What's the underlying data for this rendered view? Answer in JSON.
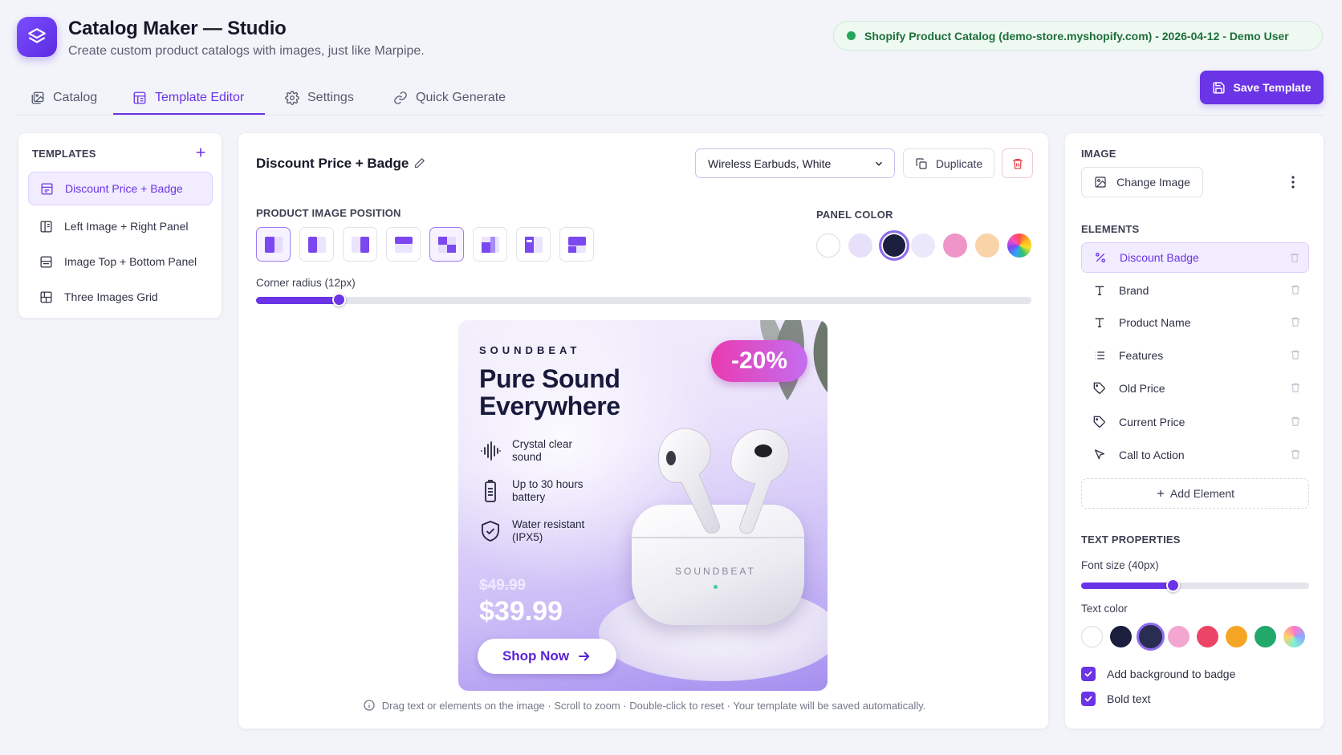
{
  "app": {
    "title": "Catalog Maker — Studio",
    "subtitle": "Create custom product catalogs with images, just like Marpipe.",
    "status": "Shopify Product Catalog (demo-store.myshopify.com) - 2026-04-12 - Demo User"
  },
  "tabs": [
    {
      "label": "Catalog",
      "icon": "catalog-icon"
    },
    {
      "label": "Template Editor",
      "icon": "template-icon",
      "active": true
    },
    {
      "label": "Settings",
      "icon": "gear-icon"
    },
    {
      "label": "Quick Generate",
      "icon": "link-icon"
    }
  ],
  "save_label": "Save Template",
  "templates": {
    "heading": "TEMPLATES",
    "items": [
      {
        "label": "Discount Price + Badge",
        "active": true
      },
      {
        "label": "Left Image + Right Panel"
      },
      {
        "label": "Image Top + Bottom Panel"
      },
      {
        "label": "Three Images Grid"
      }
    ]
  },
  "editor": {
    "template_name": "Discount Price + Badge",
    "product_select": "Wireless Earbuds, White",
    "duplicate_label": "Duplicate",
    "position_heading": "PRODUCT IMAGE POSITION",
    "panel_color_heading": "PANEL COLOR",
    "panel_colors": [
      "#ffffff",
      "#e6e0fb",
      "#1c1f3f",
      "#ece8fb",
      "#f095c8",
      "#f8d4a8",
      "rainbow"
    ],
    "panel_color_selected": 2,
    "corner_radius_label": "Corner radius (12px)",
    "corner_radius_value": 12,
    "hint": "Drag text or elements on the image · Scroll to zoom · Double-click to reset · Your template will be saved automatically."
  },
  "preview": {
    "brand": "SOUNDBEAT",
    "headline": "Pure Sound Everywhere",
    "features": [
      {
        "icon": "waveform-icon",
        "text": "Crystal clear sound"
      },
      {
        "icon": "battery-icon",
        "text": "Up to 30 hours battery"
      },
      {
        "icon": "shield-check-icon",
        "text": "Water resistant (IPX5)"
      }
    ],
    "discount": "-20%",
    "old_price": "$49.99",
    "current_price": "$39.99",
    "cta": "Shop Now",
    "case_brand": "SOUNDBEAT"
  },
  "right": {
    "image_heading": "IMAGE",
    "change_image_label": "Change Image",
    "elements_heading": "ELEMENTS",
    "elements": [
      {
        "label": "Discount Badge",
        "icon": "percent-icon",
        "active": true
      },
      {
        "label": "Brand",
        "icon": "text-icon"
      },
      {
        "label": "Product Name",
        "icon": "text-icon"
      },
      {
        "label": "Features",
        "icon": "list-icon"
      },
      {
        "label": "Old Price",
        "icon": "tag-icon"
      },
      {
        "label": "Current Price",
        "icon": "tag-icon"
      },
      {
        "label": "Call to Action",
        "icon": "cursor-icon"
      }
    ],
    "add_element_label": "Add Element",
    "text_props_heading": "TEXT PROPERTIES",
    "font_size_label": "Font size (40px)",
    "font_size_value": 40,
    "text_color_label": "Text color",
    "text_colors": [
      "#ffffff",
      "#1b1e3c",
      "#2a2d52",
      "#f3a6cf",
      "#ec4466",
      "#f5a524",
      "#22a86b",
      "gradient"
    ],
    "text_color_selected": 2,
    "checkbox_badge_bg": "Add background to badge",
    "checkbox_bold": "Bold text"
  },
  "colors": {
    "accent": "#6b34e6",
    "success": "#23a55a",
    "danger": "#e5484d"
  }
}
